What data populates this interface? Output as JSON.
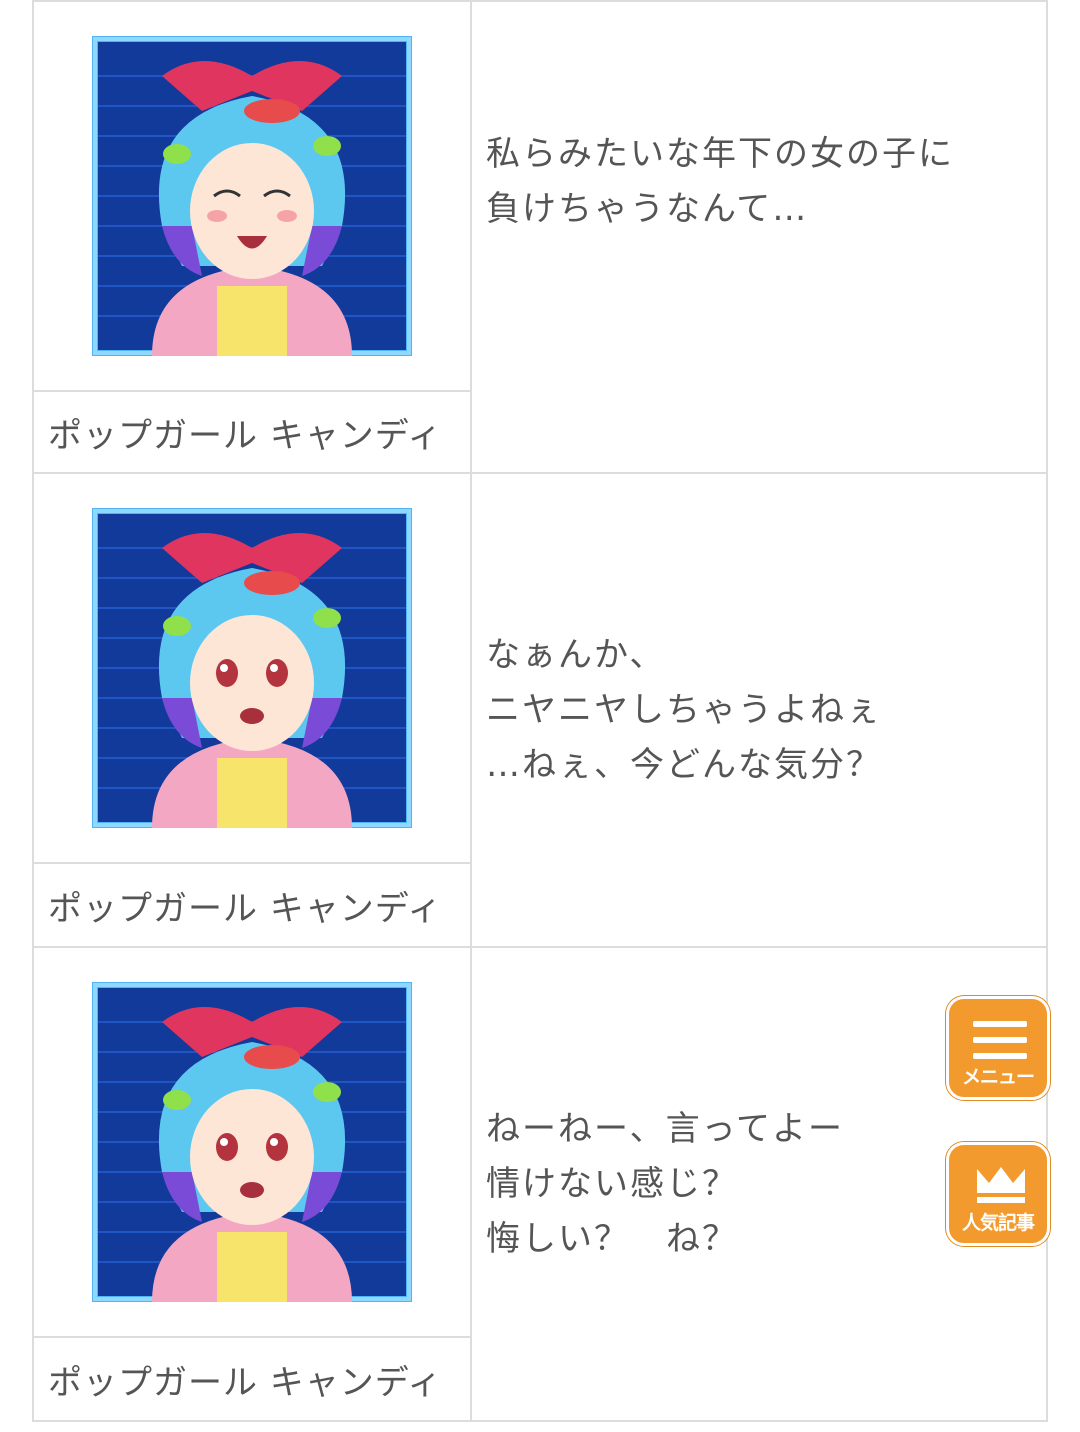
{
  "dialogue": [
    {
      "speaker": "ポップガール キャンディ",
      "expression": "eyes-closed-laughing",
      "lines": [
        "私らみたいな年下の女の子に",
        "負けちゃうなんて…"
      ]
    },
    {
      "speaker": "ポップガール キャンディ",
      "expression": "eyes-open",
      "lines": [
        "なぁんか、",
        "ニヤニヤしちゃうよねぇ",
        "…ねぇ、今どんな気分？"
      ]
    },
    {
      "speaker": "ポップガール キャンディ",
      "expression": "eyes-open",
      "lines": [
        "ねーねー、言ってよー",
        "情けない感じ？",
        "悔しい？　ね？"
      ]
    }
  ],
  "floating_buttons": {
    "menu": {
      "label": "メニュー",
      "icon": "hamburger-icon"
    },
    "popular": {
      "label": "人気記事",
      "icon": "crown-icon"
    }
  },
  "colors": {
    "accent": "#f39a2e",
    "border": "#dcdcdc",
    "text": "#555555",
    "hair": "#5cc8f0",
    "hair_tip": "#7a4bd6",
    "ribbon": "#e0355f",
    "frame_bg": "#123a9a"
  }
}
